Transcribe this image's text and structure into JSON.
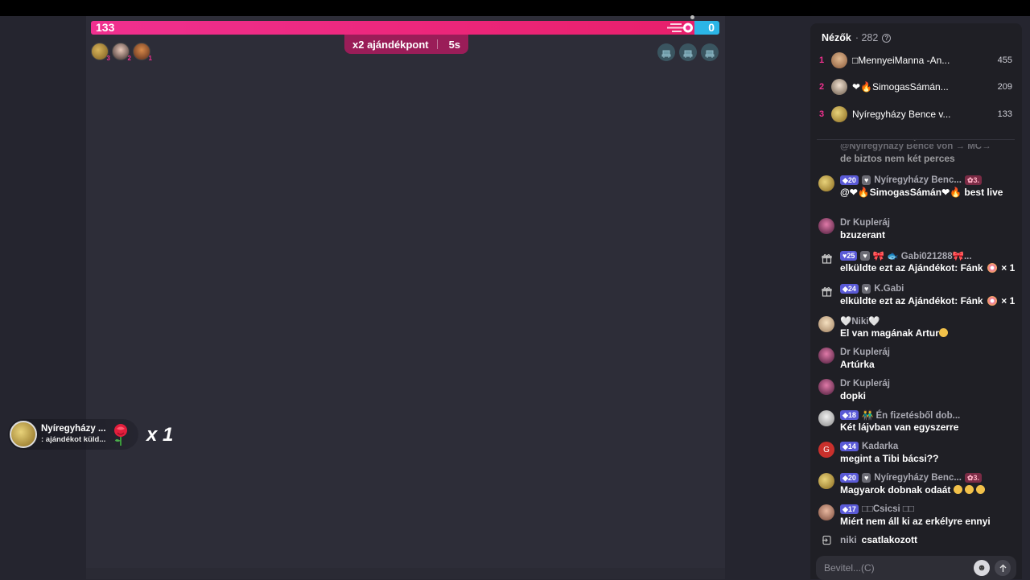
{
  "battle": {
    "left_score": "133",
    "right_score": "0",
    "left_fraction": 0.96,
    "multiplier_label": "x2 ajándékpont",
    "multiplier_timer": "5s",
    "left_avatar_ranks": [
      "3",
      "2",
      "1"
    ],
    "left_color": "#f0308f",
    "right_color": "#2bb5e6"
  },
  "gift_toast": {
    "sender": "Nyíregyházy ...",
    "subtitle": ": ajándékot küld...",
    "count": "x 1",
    "gift_icon": "rose-icon"
  },
  "viewers": {
    "title": "Nézők",
    "count": "· 282",
    "top": [
      {
        "rank": "1",
        "name": "□MennyeiManna -An...",
        "score": "455"
      },
      {
        "rank": "2",
        "name": "❤🔥SimogasSámán...",
        "score": "209"
      },
      {
        "rank": "3",
        "name": "Nyíregyházy Bence v...",
        "score": "133"
      }
    ]
  },
  "chat": {
    "messages": [
      {
        "name": "@Nyíregyházy Bence von → MC→",
        "text": "de biztos nem két perces"
      },
      {
        "level": "20",
        "name": "Nyíregyházy Benc...",
        "rank_badge": "3.",
        "text": "@❤🔥SimogasSámán❤🔥 best live"
      },
      {
        "name": "Dr Kupleráj",
        "text": "bzuzerant"
      },
      {
        "level": "25",
        "name": "🎀 🐟 Gabi021288🎀...",
        "text": "elküldte ezt az Ajándékot: Fánk",
        "count": "× 1"
      },
      {
        "level": "24",
        "name": "K.Gabi",
        "text": "elküldte ezt az Ajándékot: Fánk",
        "count": "× 1"
      },
      {
        "name": "🤍Niki🤍",
        "text": "El van magának Artur"
      },
      {
        "name": "Dr Kupleráj",
        "text": "Artúrka"
      },
      {
        "name": "Dr Kupleráj",
        "text": "dopki"
      },
      {
        "level": "18",
        "name": "👬 Én fizetésből dob...",
        "text": "Két lájvban van egyszerre"
      },
      {
        "level": "14",
        "name": "Kadarka",
        "text": "megint a Tibi bácsi??"
      },
      {
        "level": "20",
        "name": "Nyíregyházy Benc...",
        "rank_badge": "3.",
        "text": "Magyarok dobnak odaát"
      },
      {
        "level": "17",
        "name": "□□Csicsi □□",
        "text": "Miért nem áll ki az erkélyre ennyi"
      }
    ],
    "join": {
      "name": "niki",
      "text": "csatlakozott"
    },
    "input_placeholder": "Bevitel...(C)"
  }
}
